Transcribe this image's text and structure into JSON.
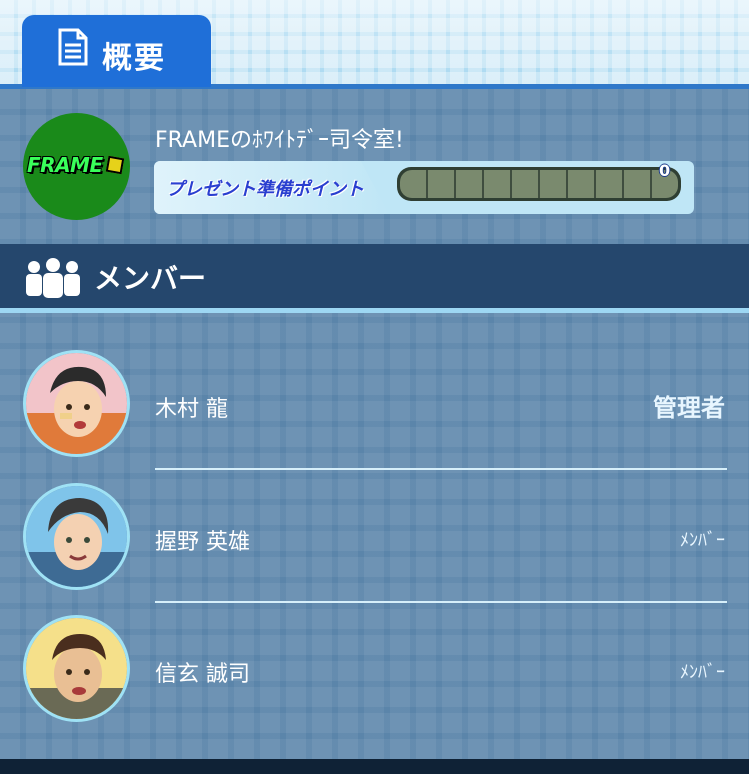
{
  "tab": {
    "label": "概要",
    "icon": "document-icon"
  },
  "office": {
    "logo_text": "FRAME",
    "name": "FRAMEのﾎﾜｲﾄﾃﾞｰ司令室!",
    "points_label": "プレゼント準備ポイント",
    "points_value": "0",
    "points_progress": 0
  },
  "members_section": {
    "title": "メンバー",
    "icon": "people-icon"
  },
  "members": [
    {
      "name": "木村 龍",
      "role": "管理者"
    },
    {
      "name": "握野 英雄",
      "role": "ﾒﾝﾊﾞｰ"
    },
    {
      "name": "信玄 誠司",
      "role": "ﾒﾝﾊﾞｰ"
    }
  ],
  "colors": {
    "accent_blue": "#1f6fd8",
    "header_dark": "#25476d",
    "content_bg": "#5b85aa"
  }
}
